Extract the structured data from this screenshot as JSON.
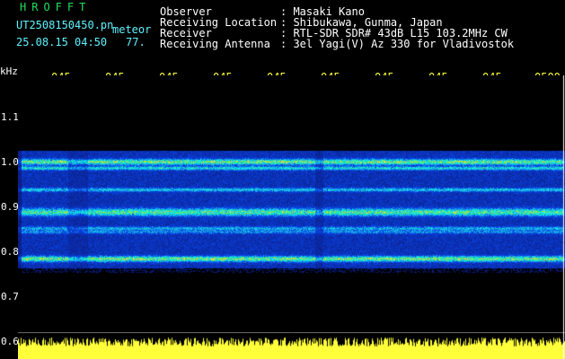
{
  "header": {
    "brand": "HROFFT",
    "filename": "UT2508150450.pn",
    "type_label": "meteor",
    "datetime": "25.08.15 04:50",
    "count": "77."
  },
  "info": {
    "observer_label": "Observer",
    "observer_value": ": Masaki Kano",
    "location_label": "Receiving Location",
    "location_value": ": Shibukawa, Gunma, Japan",
    "receiver_label": "Receiver",
    "receiver_value": ": RTL-SDR SDR# 43dB L15 103.2MHz CW",
    "antenna_label": "Receiving Antenna",
    "antenna_value": ": 3el Yagi(V) Az 330 for Vladivostok"
  },
  "axis": {
    "unit": "kHz",
    "time_ticks": [
      "045",
      "045",
      "045",
      "045",
      "045",
      "045",
      "045",
      "045",
      "045",
      "0500"
    ],
    "freq_ticks": [
      "1.1",
      "1.0",
      "0.9",
      "0.8",
      "0.7",
      "0.6"
    ]
  },
  "colors": {
    "background": "#000000",
    "signal_low": "#0a1a8c",
    "signal_mid": "#2ad2ff",
    "signal_high": "#ffff3a",
    "reference_line": "#ffffff"
  }
}
